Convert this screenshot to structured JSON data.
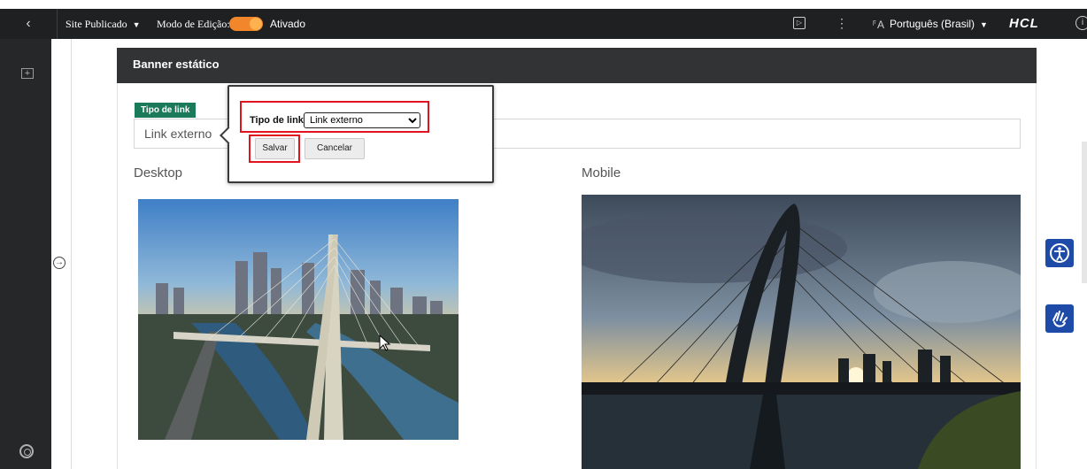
{
  "topbar": {
    "back_icon": "chevron-left-icon",
    "site_label": "Site Publicado",
    "edit_mode_label": "Modo de Edição:",
    "edit_mode_state": "Ativado",
    "edit_mode_on": true,
    "language": "Português (Brasil)",
    "brand": "HCL",
    "colors": {
      "background": "#1f2022",
      "toggle": "#f1872a"
    }
  },
  "card": {
    "title": "Banner estático",
    "link_tag": "Tipo de link",
    "link_value": "Link externo",
    "desktop_label": "Desktop",
    "mobile_label": "Mobile",
    "tag_color": "#1b7a5a"
  },
  "popup": {
    "label": "Tipo de link",
    "selected": "Link externo",
    "save": "Salvar",
    "cancel": "Cancelar",
    "highlight_color": "#e0141e"
  },
  "side_buttons": {
    "accessibility": "accessibility-icon",
    "sign_language": "sign-language-icon",
    "color": "#1e4ba8"
  }
}
